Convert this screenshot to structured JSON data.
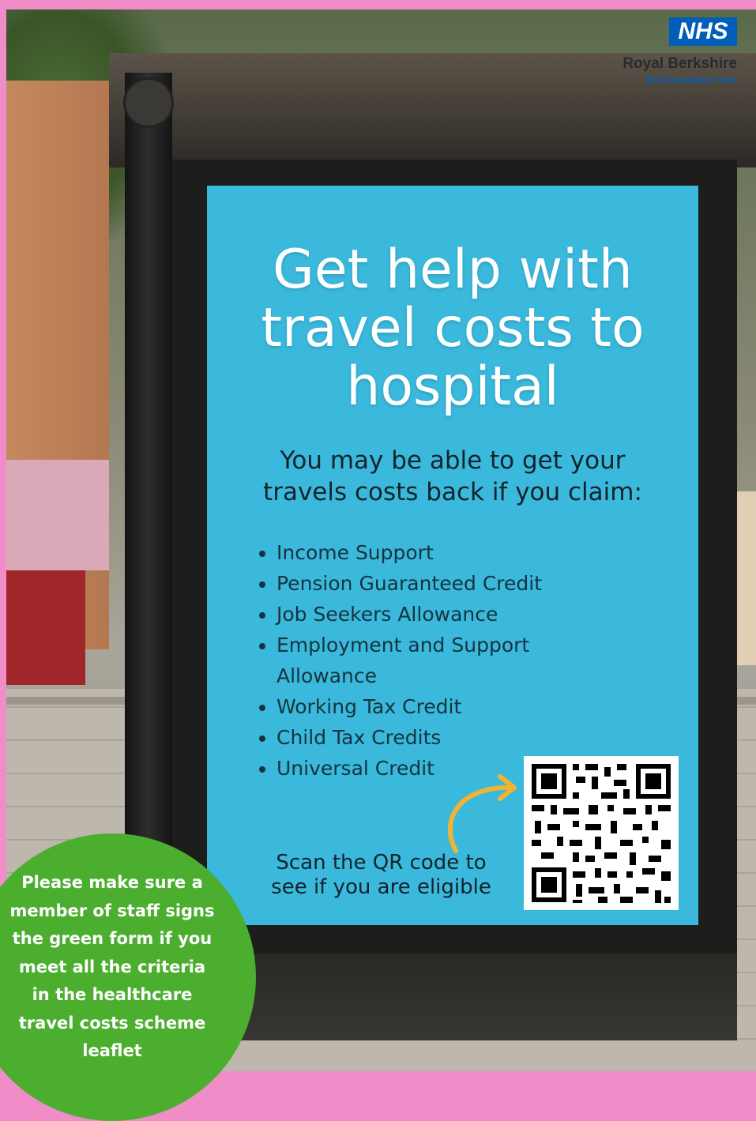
{
  "nhs_logo": {
    "badge": "NHS",
    "trust_name": "Royal Berkshire",
    "trust_subtitle": "NHS Foundation Trust",
    "brand_color": "#005eb8"
  },
  "poster": {
    "background_color": "#3ab9dc",
    "headline_lines": [
      "Get help with",
      "travel costs to",
      "hospital"
    ],
    "intro_lines": [
      "You may be able to get your",
      "travels costs back if you claim:"
    ],
    "benefits": [
      "Income Support",
      "Pension Guaranteed Credit",
      "Job Seekers Allowance",
      "Employment and Support Allowance",
      "Working Tax Credit",
      "Child Tax Credits",
      "Universal Credit"
    ],
    "scan_lines": [
      "Scan the QR code to",
      "see if you are eligible"
    ],
    "arrow_color": "#f2b233"
  },
  "green_notice": {
    "background_color": "#4bae2f",
    "lines": [
      "Please make sure a",
      "member of staff signs",
      "the green form if you",
      "meet all the criteria",
      "in the healthcare",
      "travel costs scheme",
      "leaflet"
    ]
  },
  "scene": {
    "border_color": "#f08cc8"
  }
}
